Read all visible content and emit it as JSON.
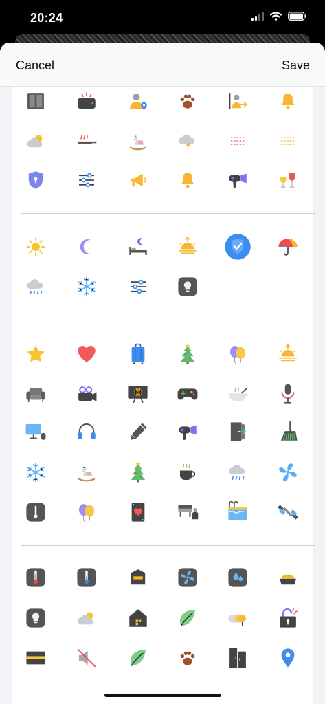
{
  "status_bar": {
    "time": "20:24"
  },
  "nav": {
    "cancel_label": "Cancel",
    "save_label": "Save"
  },
  "sections": [
    {
      "rows": [
        [
          "split-panel-icon",
          "toaster-icon",
          "user-location-icon",
          "paw-icon",
          "user-exit-icon",
          "bell-icon"
        ],
        [
          "partly-cloudy-icon",
          "frying-pan-icon",
          "rocking-horse-icon",
          "thunderstorm-icon",
          "heat-lines-red-icon",
          "heat-lines-yellow-icon"
        ],
        [
          "shield-lock-icon",
          "sliders-icon",
          "megaphone-icon",
          "bell-icon",
          "hair-dryer-icon",
          "wine-glasses-icon"
        ]
      ]
    },
    {
      "rows": [
        [
          "sun-icon",
          "moon-icon",
          "bed-night-icon",
          "sunrise-icon",
          "shield-check-icon",
          "umbrella-icon"
        ],
        [
          "rain-cloud-icon",
          "snowflake-icon",
          "sliders-icon",
          "light-bulb-tile-icon"
        ]
      ]
    },
    {
      "rows": [
        [
          "star-icon",
          "heart-icon",
          "suitcase-icon",
          "christmas-tree-icon",
          "balloons-icon",
          "sunrise-icon"
        ],
        [
          "armchair-icon",
          "video-camera-icon",
          "basketball-tv-icon",
          "gamepad-icon",
          "steaming-bowl-icon",
          "microphone-icon"
        ],
        [
          "computer-icon",
          "headphones-icon",
          "pencil-icon",
          "hair-dryer-icon",
          "door-enter-icon",
          "broom-icon"
        ],
        [
          "snowflake-icon",
          "rocking-horse-icon",
          "christmas-tree-icon",
          "coffee-cup-icon",
          "rain-cloud-icon",
          "fan-icon"
        ],
        [
          "thermometer-tile-icon",
          "balloons-icon",
          "heart-card-icon",
          "table-chair-icon",
          "pool-icon",
          "dumbbell-icon"
        ]
      ]
    },
    {
      "rows": [
        [
          "thermometer-hot-icon",
          "thermometer-cold-icon",
          "mailbox-icon",
          "fan-tile-icon",
          "humidity-tile-icon",
          "pet-bowl-icon"
        ],
        [
          "light-bulb-tile-icon",
          "partly-cloudy-icon",
          "house-icon",
          "leaf-icon",
          "coin-toggle-icon",
          "alarm-lock-icon"
        ],
        [
          "credit-card-icon",
          "mute-icon",
          "leaf-icon",
          "paw-icon",
          "double-door-icon",
          "location-pin-icon"
        ]
      ]
    }
  ]
}
